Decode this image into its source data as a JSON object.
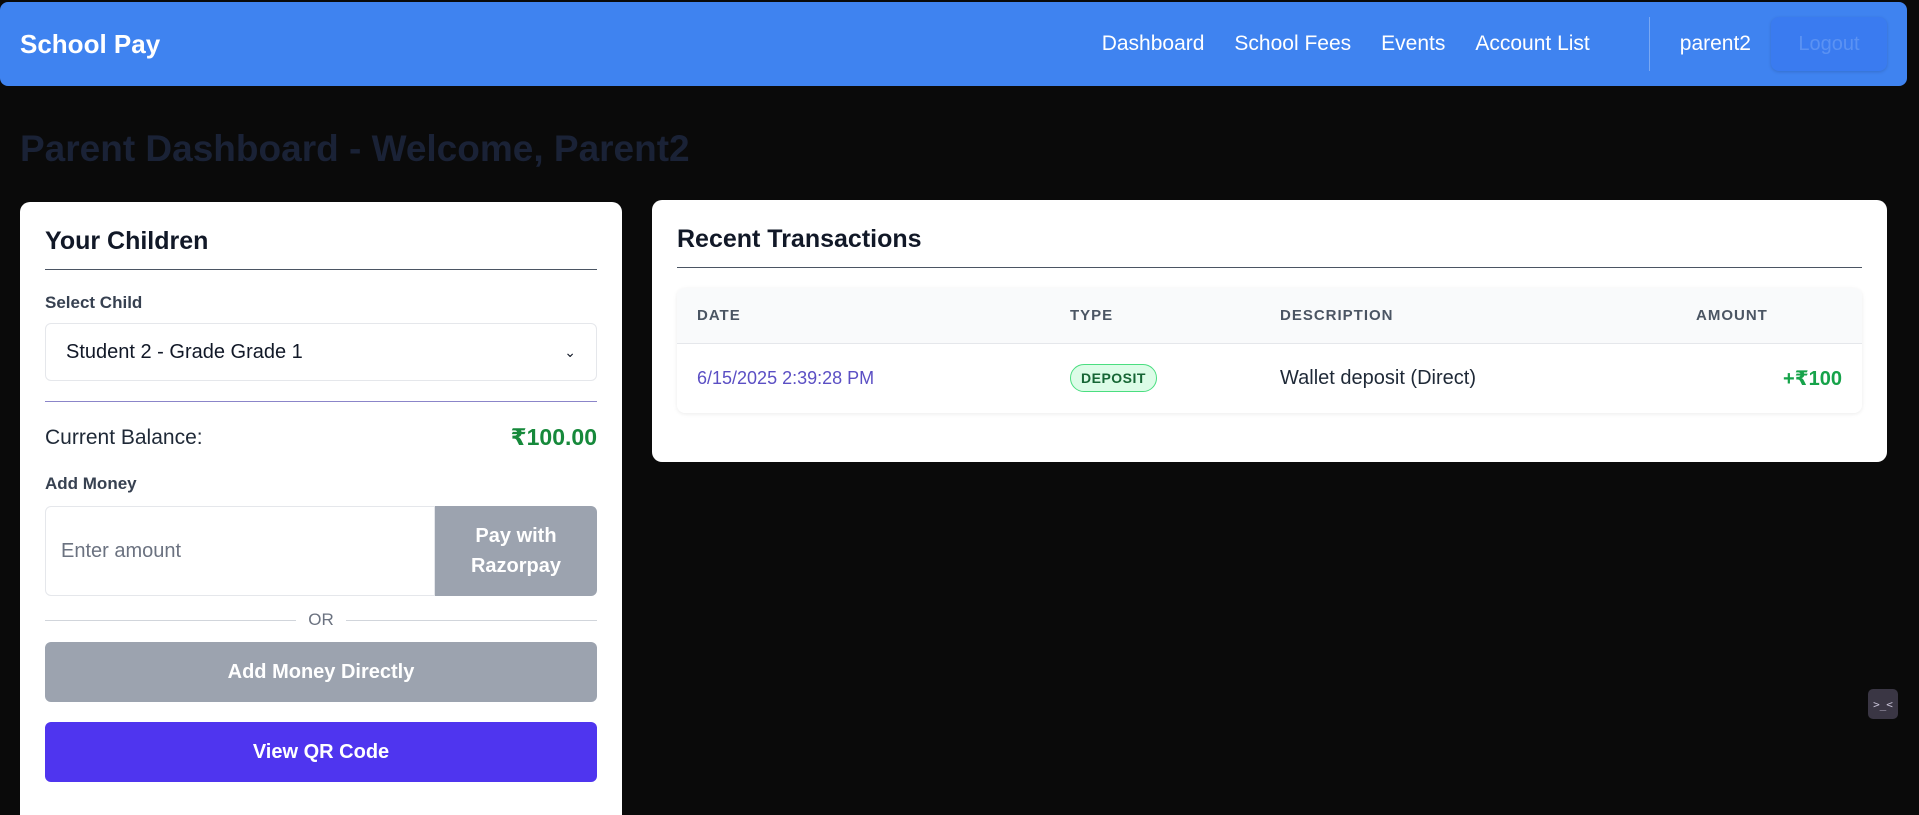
{
  "nav": {
    "brand": "School Pay",
    "links": [
      "Dashboard",
      "School Fees",
      "Events",
      "Account List"
    ],
    "username": "parent2",
    "logout": "Logout"
  },
  "page_title": "Parent Dashboard - Welcome, Parent2",
  "children_card": {
    "title": "Your Children",
    "select_label": "Select Child",
    "selected_child": "Student 2 - Grade Grade 1",
    "balance_label": "Current Balance:",
    "balance_value": "₹100.00",
    "add_money_label": "Add Money",
    "amount_placeholder": "Enter amount",
    "razorpay_button": "Pay with Razorpay",
    "or_text": "OR",
    "direct_button": "Add Money Directly",
    "qr_button": "View QR Code"
  },
  "transactions": {
    "title": "Recent Transactions",
    "columns": [
      "DATE",
      "TYPE",
      "DESCRIPTION",
      "AMOUNT"
    ],
    "rows": [
      {
        "date": "6/15/2025 2:39:28 PM",
        "type": "DEPOSIT",
        "description": "Wallet deposit (Direct)",
        "amount": "+₹100"
      }
    ]
  },
  "colors": {
    "navbar": "#3f83f0",
    "balance": "#16893b",
    "primary_button": "#4f35ef",
    "disabled_button": "#9ca3af"
  },
  "icons": [
    "chevron-down-icon",
    "dev-tools-icon"
  ]
}
